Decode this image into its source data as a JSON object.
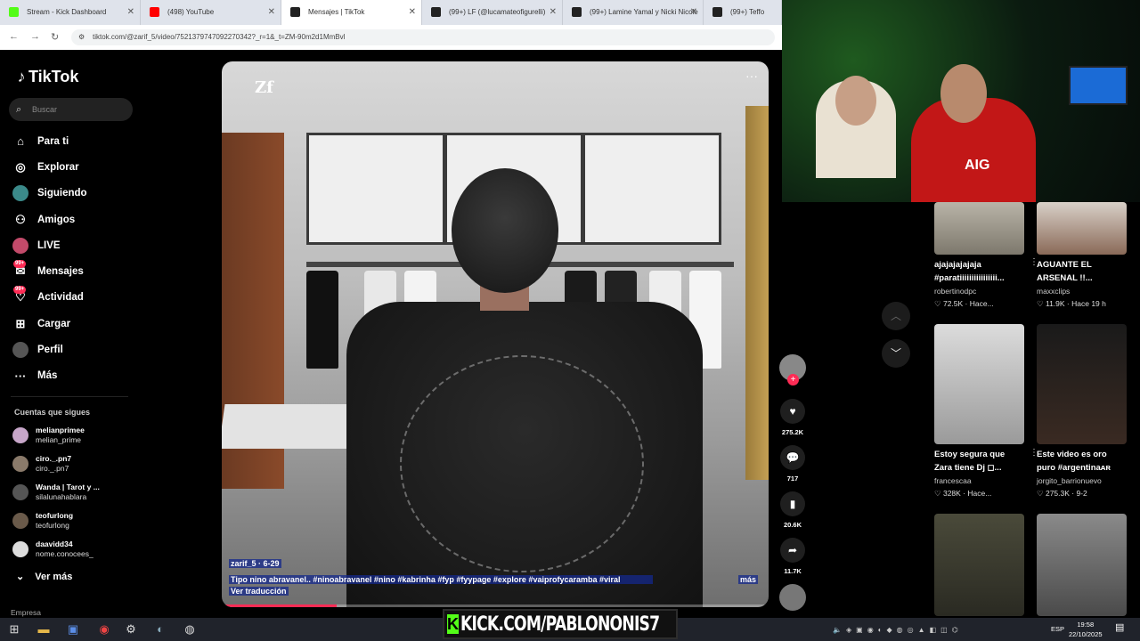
{
  "browser": {
    "tabs": [
      {
        "label": "Stream - Kick Dashboard",
        "color": "#53fc18"
      },
      {
        "label": "(498) YouTube",
        "color": "#ff0000"
      },
      {
        "label": "Mensajes | TikTok",
        "color": "#222222"
      },
      {
        "label": "(99+) LF (@lucamateofigurelli)",
        "color": "#222222"
      },
      {
        "label": "(99+) Lamine Yamal y Nicki Nicole",
        "color": "#222222"
      },
      {
        "label": "(99+) Teffo",
        "color": "#222222"
      }
    ],
    "url": "tiktok.com/@zarif_5/video/7521379747092270342?_r=1&_t=ZM-90m2d1MmBvl"
  },
  "sidebar": {
    "logo": "TikTok",
    "search_placeholder": "Buscar",
    "nav": [
      {
        "label": "Para ti",
        "icon": "home-icon",
        "glyph": "⌂"
      },
      {
        "label": "Explorar",
        "icon": "compass-icon",
        "glyph": "◎"
      },
      {
        "label": "Siguiendo",
        "icon": "following-avatar-icon",
        "glyph": "●"
      },
      {
        "label": "Amigos",
        "icon": "friends-icon",
        "glyph": "👥"
      },
      {
        "label": "LIVE",
        "icon": "live-icon",
        "glyph": "●"
      },
      {
        "label": "Mensajes",
        "icon": "messages-icon",
        "glyph": "✉",
        "badge": "99+"
      },
      {
        "label": "Actividad",
        "icon": "activity-icon",
        "glyph": "♡",
        "badge": "99+"
      },
      {
        "label": "Cargar",
        "icon": "upload-icon",
        "glyph": "⊞"
      },
      {
        "label": "Perfil",
        "icon": "profile-icon",
        "glyph": "●"
      },
      {
        "label": "Más",
        "icon": "more-dots-icon",
        "glyph": "···"
      }
    ],
    "following_title": "Cuentas que sigues",
    "following": [
      {
        "name": "melianprimee",
        "handle": "melian_prime"
      },
      {
        "name": "ciro._.pn7",
        "handle": "ciro._.pn7"
      },
      {
        "name": "Wanda | Tarot y ...",
        "handle": "silalunahablara"
      },
      {
        "name": "teofurlong",
        "handle": "teofurlong"
      },
      {
        "name": "daavidd34",
        "handle": "nome.conocees_"
      }
    ],
    "see_more": "Ver más",
    "company": "Empresa"
  },
  "video": {
    "watermark": "Zf",
    "author_line": "zarif_5 · 6-29",
    "caption": "Tipo nino abravanel.. #ninoabravanel #nino #kabrinha #fyp #fyypage #explore #vaiprofycaramba #viral",
    "more_label": "más",
    "translate_label": "Ver traducción",
    "progress": 0.21
  },
  "actions": {
    "likes": "275.2K",
    "comments": "717",
    "saves": "20.6K",
    "shares": "11.7K"
  },
  "suggestions": [
    {
      "title1": "ajajajajajaja",
      "title2": "#paratiiiiiiiiiiiiiiii...",
      "user": "robertinodpc",
      "meta": "♡ 72.5K · Hace..."
    },
    {
      "title1": "AGUANTE EL",
      "title2": "ARSENAL !!...",
      "user": "maxxclips",
      "meta": "♡ 11.9K · Hace 19 h"
    },
    {
      "title1": "Estoy segura que",
      "title2": "Zara tiene Dj ◻...",
      "user": "francescaa",
      "meta": "♡ 328K · Hace..."
    },
    {
      "title1": "Este video es oro",
      "title2": "puro #argentinaᴀʀ",
      "user": "jorgito_barrionuevo",
      "meta": "♡ 275.3K · 9-2"
    }
  ],
  "webcam": {
    "shirt_text": "AIG"
  },
  "overlay": {
    "kick_text": "KICK.COM/PABLONONIS7"
  },
  "taskbar": {
    "lang": "ESP",
    "time": "19:58",
    "date": "22/10/2025"
  }
}
